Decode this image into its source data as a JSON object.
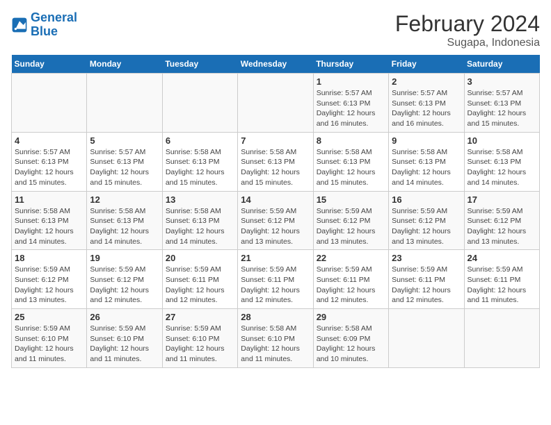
{
  "logo": {
    "line1": "General",
    "line2": "Blue"
  },
  "title": "February 2024",
  "subtitle": "Sugapa, Indonesia",
  "weekdays": [
    "Sunday",
    "Monday",
    "Tuesday",
    "Wednesday",
    "Thursday",
    "Friday",
    "Saturday"
  ],
  "weeks": [
    [
      {
        "day": "",
        "info": ""
      },
      {
        "day": "",
        "info": ""
      },
      {
        "day": "",
        "info": ""
      },
      {
        "day": "",
        "info": ""
      },
      {
        "day": "1",
        "info": "Sunrise: 5:57 AM\nSunset: 6:13 PM\nDaylight: 12 hours\nand 16 minutes."
      },
      {
        "day": "2",
        "info": "Sunrise: 5:57 AM\nSunset: 6:13 PM\nDaylight: 12 hours\nand 16 minutes."
      },
      {
        "day": "3",
        "info": "Sunrise: 5:57 AM\nSunset: 6:13 PM\nDaylight: 12 hours\nand 15 minutes."
      }
    ],
    [
      {
        "day": "4",
        "info": "Sunrise: 5:57 AM\nSunset: 6:13 PM\nDaylight: 12 hours\nand 15 minutes."
      },
      {
        "day": "5",
        "info": "Sunrise: 5:57 AM\nSunset: 6:13 PM\nDaylight: 12 hours\nand 15 minutes."
      },
      {
        "day": "6",
        "info": "Sunrise: 5:58 AM\nSunset: 6:13 PM\nDaylight: 12 hours\nand 15 minutes."
      },
      {
        "day": "7",
        "info": "Sunrise: 5:58 AM\nSunset: 6:13 PM\nDaylight: 12 hours\nand 15 minutes."
      },
      {
        "day": "8",
        "info": "Sunrise: 5:58 AM\nSunset: 6:13 PM\nDaylight: 12 hours\nand 15 minutes."
      },
      {
        "day": "9",
        "info": "Sunrise: 5:58 AM\nSunset: 6:13 PM\nDaylight: 12 hours\nand 14 minutes."
      },
      {
        "day": "10",
        "info": "Sunrise: 5:58 AM\nSunset: 6:13 PM\nDaylight: 12 hours\nand 14 minutes."
      }
    ],
    [
      {
        "day": "11",
        "info": "Sunrise: 5:58 AM\nSunset: 6:13 PM\nDaylight: 12 hours\nand 14 minutes."
      },
      {
        "day": "12",
        "info": "Sunrise: 5:58 AM\nSunset: 6:13 PM\nDaylight: 12 hours\nand 14 minutes."
      },
      {
        "day": "13",
        "info": "Sunrise: 5:58 AM\nSunset: 6:13 PM\nDaylight: 12 hours\nand 14 minutes."
      },
      {
        "day": "14",
        "info": "Sunrise: 5:59 AM\nSunset: 6:12 PM\nDaylight: 12 hours\nand 13 minutes."
      },
      {
        "day": "15",
        "info": "Sunrise: 5:59 AM\nSunset: 6:12 PM\nDaylight: 12 hours\nand 13 minutes."
      },
      {
        "day": "16",
        "info": "Sunrise: 5:59 AM\nSunset: 6:12 PM\nDaylight: 12 hours\nand 13 minutes."
      },
      {
        "day": "17",
        "info": "Sunrise: 5:59 AM\nSunset: 6:12 PM\nDaylight: 12 hours\nand 13 minutes."
      }
    ],
    [
      {
        "day": "18",
        "info": "Sunrise: 5:59 AM\nSunset: 6:12 PM\nDaylight: 12 hours\nand 13 minutes."
      },
      {
        "day": "19",
        "info": "Sunrise: 5:59 AM\nSunset: 6:12 PM\nDaylight: 12 hours\nand 12 minutes."
      },
      {
        "day": "20",
        "info": "Sunrise: 5:59 AM\nSunset: 6:11 PM\nDaylight: 12 hours\nand 12 minutes."
      },
      {
        "day": "21",
        "info": "Sunrise: 5:59 AM\nSunset: 6:11 PM\nDaylight: 12 hours\nand 12 minutes."
      },
      {
        "day": "22",
        "info": "Sunrise: 5:59 AM\nSunset: 6:11 PM\nDaylight: 12 hours\nand 12 minutes."
      },
      {
        "day": "23",
        "info": "Sunrise: 5:59 AM\nSunset: 6:11 PM\nDaylight: 12 hours\nand 12 minutes."
      },
      {
        "day": "24",
        "info": "Sunrise: 5:59 AM\nSunset: 6:11 PM\nDaylight: 12 hours\nand 11 minutes."
      }
    ],
    [
      {
        "day": "25",
        "info": "Sunrise: 5:59 AM\nSunset: 6:10 PM\nDaylight: 12 hours\nand 11 minutes."
      },
      {
        "day": "26",
        "info": "Sunrise: 5:59 AM\nSunset: 6:10 PM\nDaylight: 12 hours\nand 11 minutes."
      },
      {
        "day": "27",
        "info": "Sunrise: 5:59 AM\nSunset: 6:10 PM\nDaylight: 12 hours\nand 11 minutes."
      },
      {
        "day": "28",
        "info": "Sunrise: 5:58 AM\nSunset: 6:10 PM\nDaylight: 12 hours\nand 11 minutes."
      },
      {
        "day": "29",
        "info": "Sunrise: 5:58 AM\nSunset: 6:09 PM\nDaylight: 12 hours\nand 10 minutes."
      },
      {
        "day": "",
        "info": ""
      },
      {
        "day": "",
        "info": ""
      }
    ]
  ]
}
